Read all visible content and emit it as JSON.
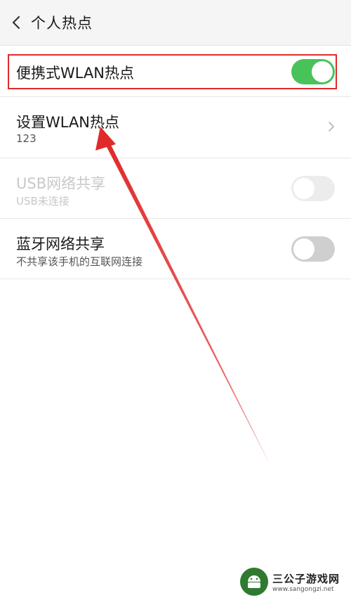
{
  "header": {
    "title": "个人热点",
    "back_icon": "chevron-left-icon"
  },
  "rows": [
    {
      "label": "便携式WLAN热点",
      "toggle": "on"
    },
    {
      "label": "设置WLAN热点",
      "sub": "123",
      "trailing_icon": "chevron-right-icon"
    },
    {
      "label": "USB网络共享",
      "sub": "USB未连接",
      "toggle": "off",
      "disabled": true
    },
    {
      "label": "蓝牙网络共享",
      "sub": "不共享该手机的互联网连接",
      "toggle": "off"
    }
  ],
  "colors": {
    "toggle_on": "#48c35a",
    "annotation_red": "#e02a2a"
  },
  "watermark": {
    "title": "三公子游戏网",
    "url": "www.sangongzi.net"
  }
}
